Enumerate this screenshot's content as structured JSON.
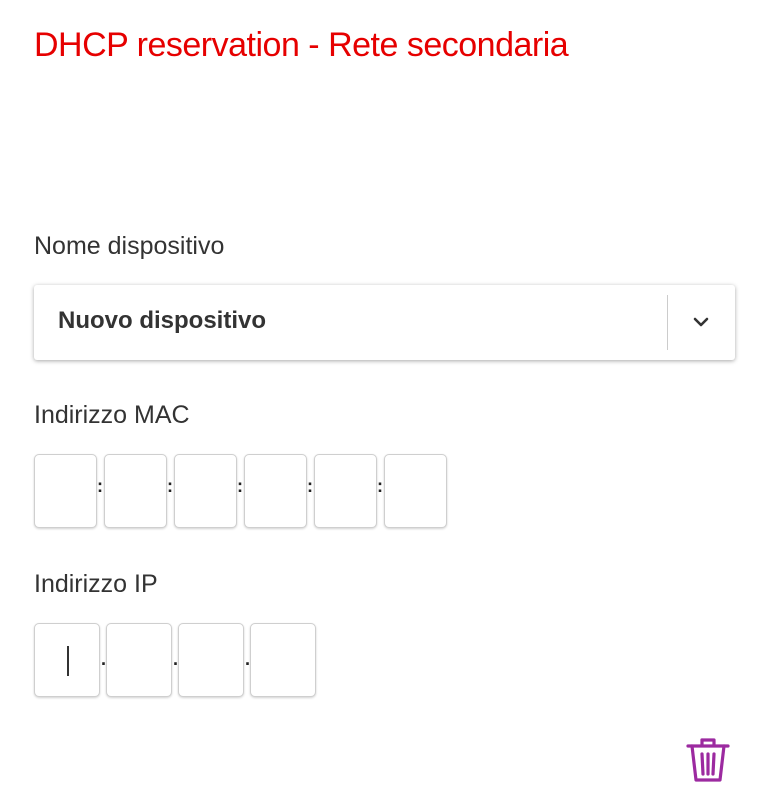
{
  "page": {
    "title": "DHCP reservation - Rete secondaria"
  },
  "device": {
    "label": "Nome dispositivo",
    "selected": "Nuovo dispositivo",
    "chevron_icon": "chevron-down-icon"
  },
  "mac": {
    "label": "Indirizzo MAC",
    "octets": [
      "",
      "",
      "",
      "",
      "",
      ""
    ],
    "separator": ":"
  },
  "ip": {
    "label": "Indirizzo IP",
    "octets": [
      "",
      "",
      "",
      ""
    ],
    "separator": "."
  },
  "actions": {
    "delete_icon": "trash-icon",
    "delete_color": "#9c2aa0"
  },
  "colors": {
    "title": "#e60000",
    "text": "#333333"
  }
}
